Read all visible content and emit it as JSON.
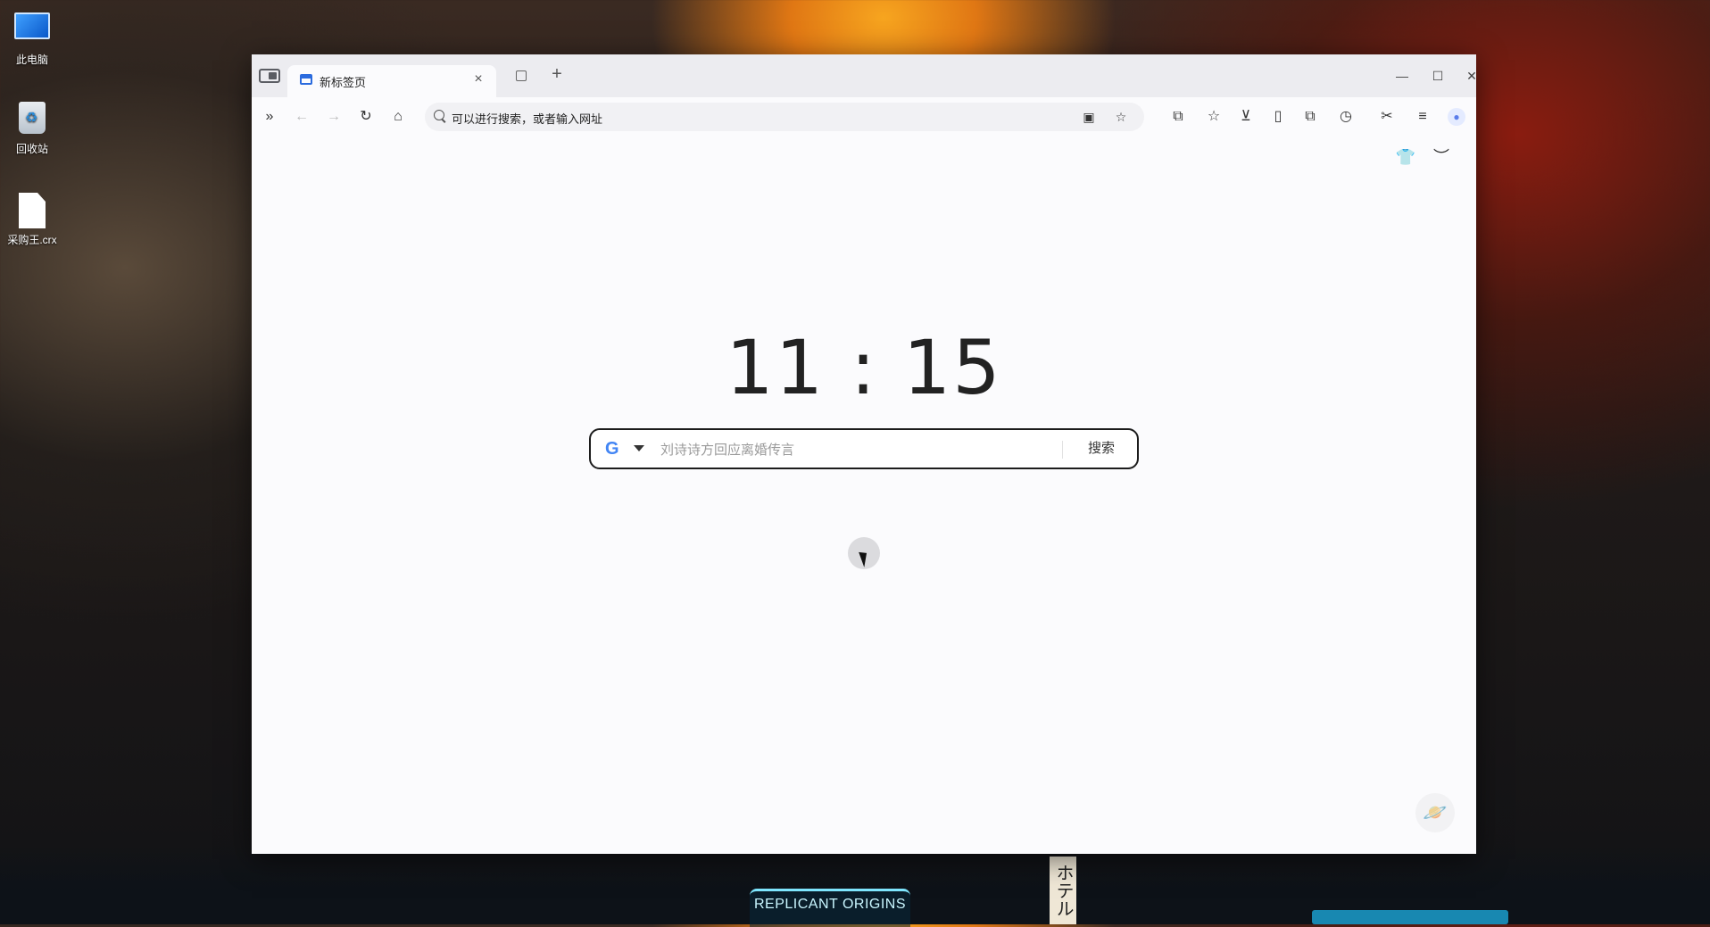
{
  "desktop": {
    "icons": [
      {
        "label": "此电脑",
        "icon": "computer-icon"
      },
      {
        "label": "回收站",
        "icon": "recycle-bin-icon"
      },
      {
        "label": "采购王.crx",
        "icon": "file-icon"
      }
    ],
    "wallpaper_sign": "REPLICANT ORIGINS",
    "wallpaper_hotel": "ホテル"
  },
  "browser": {
    "tab": {
      "title": "新标签页"
    },
    "new_tab_symbol": "+",
    "close_symbol": "×",
    "window_controls": {
      "minimize": "—",
      "maximize": "☐",
      "close": "✕"
    },
    "omnibox": {
      "placeholder": "可以进行搜索，或者输入网址"
    },
    "accent": "#2b6bde"
  },
  "newtab": {
    "clock": "11 : 15",
    "search": {
      "engine": "G",
      "placeholder": "刘诗诗方回应离婚传言",
      "button": "搜索"
    }
  }
}
